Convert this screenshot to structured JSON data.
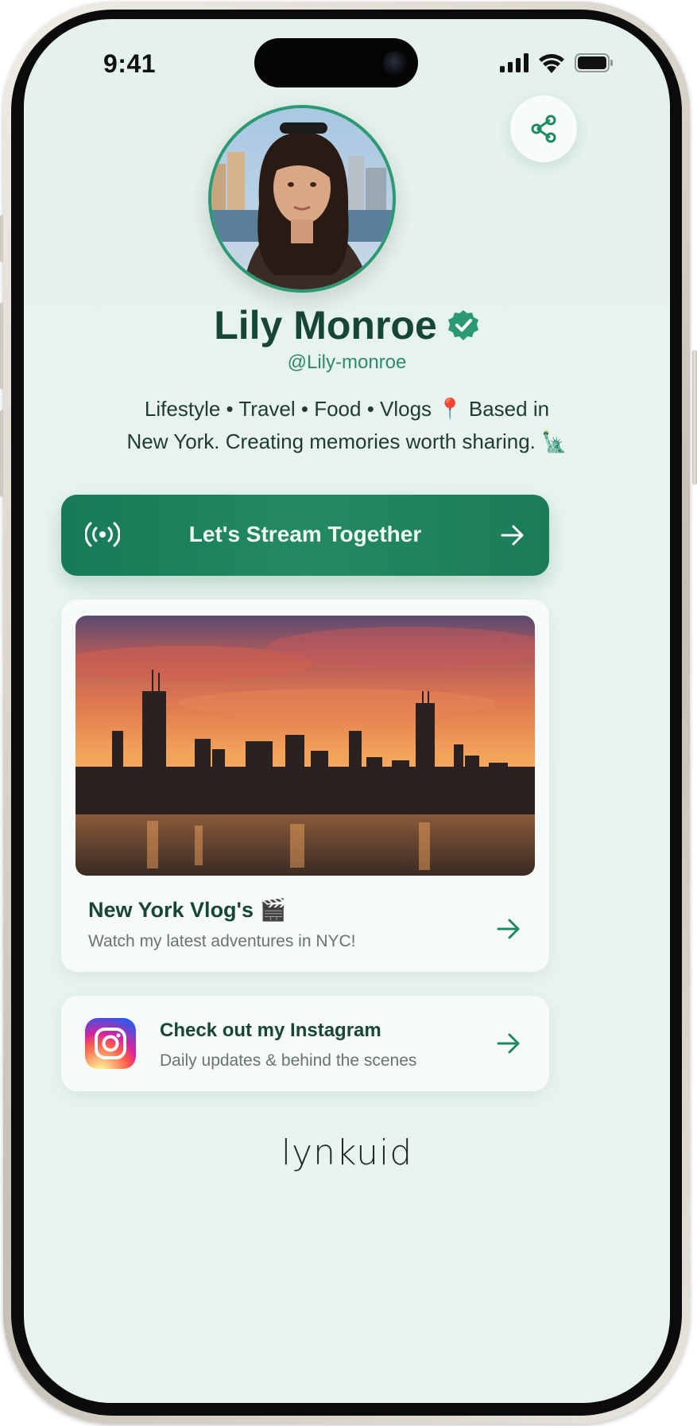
{
  "status_bar": {
    "time": "9:41"
  },
  "profile": {
    "name": "Lily Monroe",
    "handle": "@Lily-monroe",
    "bio_line1": "Lifestyle • Travel • Food • Vlogs 📍 Based in",
    "bio_line2": "New York. Creating memories worth sharing. 🗽",
    "verified": true
  },
  "cta": {
    "label": "Let's Stream Together"
  },
  "vlog": {
    "title": "New York Vlog's 🎬",
    "subtitle": "Watch my latest adventures in NYC!"
  },
  "instagram": {
    "title": "Check out my Instagram",
    "subtitle": "Daily updates & behind the scenes"
  },
  "brand": {
    "name": "lynkuid"
  },
  "colors": {
    "accent": "#1f8a61",
    "name_text": "#174634",
    "background": "#e6f2ed"
  },
  "icons": [
    "share-icon",
    "verified-badge-icon",
    "broadcast-icon",
    "arrow-right-icon",
    "instagram-icon",
    "signal-icon",
    "wifi-icon",
    "battery-icon"
  ]
}
